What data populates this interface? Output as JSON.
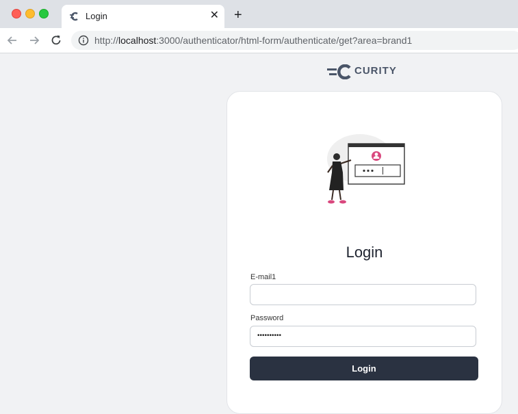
{
  "browser": {
    "tab_title": "Login",
    "tab_close": "✕",
    "new_tab": "+",
    "url_prefix": "http://",
    "url_host": "localhost",
    "url_rest": ":3000/authenticator/html-form/authenticate/get?area=brand1"
  },
  "brand": {
    "name": "CURITY",
    "color": "#4a5568"
  },
  "form": {
    "title": "Login",
    "email_label": "E-mail1",
    "email_value": "",
    "password_label": "Password",
    "password_value": "••••••••••",
    "submit_label": "Login",
    "button_color": "#2a3241"
  },
  "illustration": {
    "accent_color": "#d9487e",
    "icon": "login-illustration"
  }
}
